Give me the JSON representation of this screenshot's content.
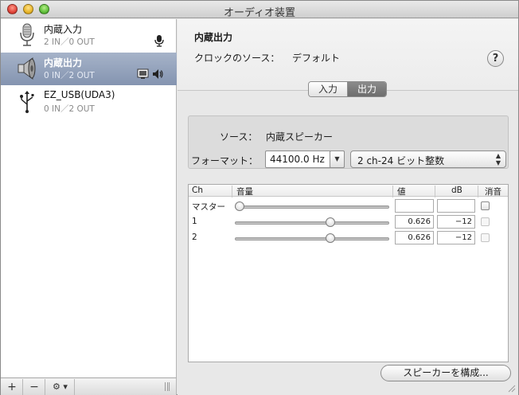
{
  "window": {
    "title": "オーディオ装置"
  },
  "devices": [
    {
      "name": "内蔵入力",
      "io": "2 IN／0 OUT",
      "selected": false,
      "icon": "microphone-icon"
    },
    {
      "name": "内蔵出力",
      "io": "0 IN／2 OUT",
      "selected": true,
      "icon": "speaker-icon"
    },
    {
      "name": "EZ_USB(UDA3)",
      "io": "0 IN／2 OUT",
      "selected": false,
      "icon": "usb-icon"
    }
  ],
  "sidebar_bottom": {
    "add": "+",
    "remove": "−",
    "gear": "⚙ ▾"
  },
  "detail": {
    "device_title": "内蔵出力",
    "clock_label": "クロックのソース：",
    "clock_value": "デフォルト",
    "help": "?"
  },
  "tabs": [
    {
      "label": "入力",
      "active": false
    },
    {
      "label": "出力",
      "active": true
    }
  ],
  "source": {
    "label": "ソース：",
    "value": "内蔵スピーカー"
  },
  "format": {
    "label": "フォーマット：",
    "rate": "44100.0 Hz",
    "bits": "2 ch-24 ビット整数"
  },
  "table": {
    "headers": {
      "ch": "Ch",
      "volume": "音量",
      "value": "値",
      "db": "dB",
      "mute": "消音"
    },
    "rows": [
      {
        "ch": "マスター",
        "level": 0.0,
        "value": "",
        "db": "",
        "mute_enabled": true
      },
      {
        "ch": "1",
        "level": 0.626,
        "value": "0.626",
        "db": "−12",
        "mute_enabled": false
      },
      {
        "ch": "2",
        "level": 0.626,
        "value": "0.626",
        "db": "−12",
        "mute_enabled": false
      }
    ]
  },
  "configure_speakers": "スピーカーを構成..."
}
